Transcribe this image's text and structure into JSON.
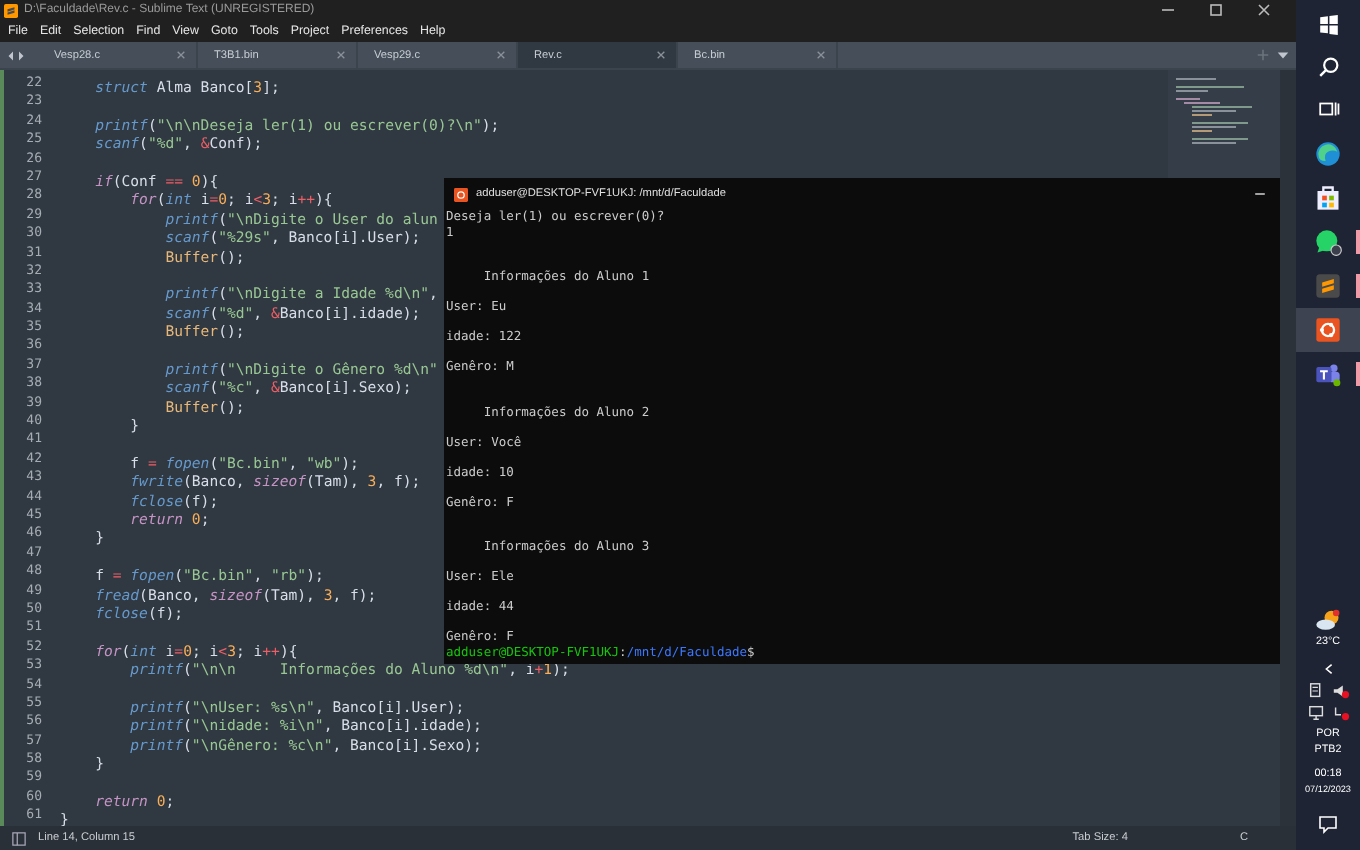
{
  "window": {
    "title": "D:\\Faculdade\\Rev.c - Sublime Text (UNREGISTERED)"
  },
  "menu": [
    "File",
    "Edit",
    "Selection",
    "Find",
    "View",
    "Goto",
    "Tools",
    "Project",
    "Preferences",
    "Help"
  ],
  "tabs": [
    {
      "label": "Vesp28.c",
      "selected": false
    },
    {
      "label": "T3B1.bin",
      "selected": false
    },
    {
      "label": "Vesp29.c",
      "selected": false
    },
    {
      "label": "Rev.c",
      "selected": true
    },
    {
      "label": "Bc.bin",
      "selected": false
    }
  ],
  "editor": {
    "lines": [
      {
        "number": "22",
        "segments": [
          {
            "kind": "type",
            "text": "    struct"
          },
          {
            "kind": "plain",
            "text": " Alma Banco["
          },
          {
            "kind": "number",
            "text": "3"
          },
          {
            "kind": "plain",
            "text": "];"
          }
        ]
      },
      {
        "number": "23"
      },
      {
        "number": "24",
        "segments": [
          {
            "kind": "function",
            "text": "    printf"
          },
          {
            "kind": "plain",
            "text": "("
          },
          {
            "kind": "string",
            "text": "\"\\n\\nDeseja ler(1) ou escrever(0)?\\n\""
          },
          {
            "kind": "plain",
            "text": ");"
          }
        ]
      },
      {
        "number": "25",
        "segments": [
          {
            "kind": "function",
            "text": "    scanf"
          },
          {
            "kind": "plain",
            "text": "("
          },
          {
            "kind": "string",
            "text": "\"%d\""
          },
          {
            "kind": "plain",
            "text": ", "
          },
          {
            "kind": "operator",
            "text": "&"
          },
          {
            "kind": "plain",
            "text": "Conf);"
          }
        ]
      },
      {
        "number": "26"
      },
      {
        "number": "27",
        "segments": [
          {
            "kind": "keyword",
            "text": "    if"
          },
          {
            "kind": "plain",
            "text": "(Conf "
          },
          {
            "kind": "operator",
            "text": "=="
          },
          {
            "kind": "number",
            "text": " 0"
          },
          {
            "kind": "plain",
            "text": "){"
          }
        ]
      },
      {
        "number": "28",
        "segments": [
          {
            "kind": "keyword",
            "text": "        for"
          },
          {
            "kind": "plain",
            "text": "("
          },
          {
            "kind": "type",
            "text": "int"
          },
          {
            "kind": "plain",
            "text": " i"
          },
          {
            "kind": "operator",
            "text": "="
          },
          {
            "kind": "number",
            "text": "0"
          },
          {
            "kind": "plain",
            "text": "; i"
          },
          {
            "kind": "operator",
            "text": "<"
          },
          {
            "kind": "number",
            "text": "3"
          },
          {
            "kind": "plain",
            "text": "; i"
          },
          {
            "kind": "operator",
            "text": "++"
          },
          {
            "kind": "plain",
            "text": "){"
          }
        ]
      },
      {
        "number": "29",
        "segments": [
          {
            "kind": "function",
            "text": "            printf"
          },
          {
            "kind": "plain",
            "text": "("
          },
          {
            "kind": "string",
            "text": "\"\\nDigite o User do alun"
          }
        ]
      },
      {
        "number": "30",
        "segments": [
          {
            "kind": "function",
            "text": "            scanf"
          },
          {
            "kind": "plain",
            "text": "("
          },
          {
            "kind": "string",
            "text": "\"%29s\""
          },
          {
            "kind": "plain",
            "text": ", Banco[i].User);"
          }
        ]
      },
      {
        "number": "31",
        "segments": [
          {
            "kind": "call",
            "text": "            Buffer"
          },
          {
            "kind": "plain",
            "text": "();"
          }
        ]
      },
      {
        "number": "32"
      },
      {
        "number": "33",
        "segments": [
          {
            "kind": "function",
            "text": "            printf"
          },
          {
            "kind": "plain",
            "text": "("
          },
          {
            "kind": "string",
            "text": "\"\\nDigite a Idade %d\\n\""
          },
          {
            "kind": "plain",
            "text": ","
          }
        ]
      },
      {
        "number": "34",
        "segments": [
          {
            "kind": "function",
            "text": "            scanf"
          },
          {
            "kind": "plain",
            "text": "("
          },
          {
            "kind": "string",
            "text": "\"%d\""
          },
          {
            "kind": "plain",
            "text": ", "
          },
          {
            "kind": "operator",
            "text": "&"
          },
          {
            "kind": "plain",
            "text": "Banco[i].idade);"
          }
        ]
      },
      {
        "number": "35",
        "segments": [
          {
            "kind": "call",
            "text": "            Buffer"
          },
          {
            "kind": "plain",
            "text": "();"
          }
        ]
      },
      {
        "number": "36"
      },
      {
        "number": "37",
        "segments": [
          {
            "kind": "function",
            "text": "            printf"
          },
          {
            "kind": "plain",
            "text": "("
          },
          {
            "kind": "string",
            "text": "\"\\nDigite o Gênero %d\\n\""
          }
        ]
      },
      {
        "number": "38",
        "segments": [
          {
            "kind": "function",
            "text": "            scanf"
          },
          {
            "kind": "plain",
            "text": "("
          },
          {
            "kind": "string",
            "text": "\"%c\""
          },
          {
            "kind": "plain",
            "text": ", "
          },
          {
            "kind": "operator",
            "text": "&"
          },
          {
            "kind": "plain",
            "text": "Banco[i].Sexo);"
          }
        ]
      },
      {
        "number": "39",
        "segments": [
          {
            "kind": "call",
            "text": "            Buffer"
          },
          {
            "kind": "plain",
            "text": "();"
          }
        ]
      },
      {
        "number": "40",
        "segments": [
          {
            "kind": "plain",
            "text": "        }"
          }
        ]
      },
      {
        "number": "41"
      },
      {
        "number": "42",
        "segments": [
          {
            "kind": "plain",
            "text": "        f "
          },
          {
            "kind": "operator",
            "text": "="
          },
          {
            "kind": "function",
            "text": " fopen"
          },
          {
            "kind": "plain",
            "text": "("
          },
          {
            "kind": "string",
            "text": "\"Bc.bin\""
          },
          {
            "kind": "plain",
            "text": ", "
          },
          {
            "kind": "string",
            "text": "\"wb\""
          },
          {
            "kind": "plain",
            "text": ");"
          }
        ]
      },
      {
        "number": "43",
        "segments": [
          {
            "kind": "function",
            "text": "        fwrite"
          },
          {
            "kind": "plain",
            "text": "(Banco, "
          },
          {
            "kind": "keyword",
            "text": "sizeof"
          },
          {
            "kind": "plain",
            "text": "(Tam), "
          },
          {
            "kind": "number",
            "text": "3"
          },
          {
            "kind": "plain",
            "text": ", f);"
          }
        ]
      },
      {
        "number": "44",
        "segments": [
          {
            "kind": "function",
            "text": "        fclose"
          },
          {
            "kind": "plain",
            "text": "(f);"
          }
        ]
      },
      {
        "number": "45",
        "segments": [
          {
            "kind": "keyword",
            "text": "        return"
          },
          {
            "kind": "number",
            "text": " 0"
          },
          {
            "kind": "plain",
            "text": ";"
          }
        ]
      },
      {
        "number": "46",
        "segments": [
          {
            "kind": "plain",
            "text": "    }"
          }
        ]
      },
      {
        "number": "47"
      },
      {
        "number": "48",
        "segments": [
          {
            "kind": "plain",
            "text": "    f "
          },
          {
            "kind": "operator",
            "text": "="
          },
          {
            "kind": "function",
            "text": " fopen"
          },
          {
            "kind": "plain",
            "text": "("
          },
          {
            "kind": "string",
            "text": "\"Bc.bin\""
          },
          {
            "kind": "plain",
            "text": ", "
          },
          {
            "kind": "string",
            "text": "\"rb\""
          },
          {
            "kind": "plain",
            "text": ");"
          }
        ]
      },
      {
        "number": "49",
        "segments": [
          {
            "kind": "function",
            "text": "    fread"
          },
          {
            "kind": "plain",
            "text": "(Banco, "
          },
          {
            "kind": "keyword",
            "text": "sizeof"
          },
          {
            "kind": "plain",
            "text": "(Tam), "
          },
          {
            "kind": "number",
            "text": "3"
          },
          {
            "kind": "plain",
            "text": ", f);"
          }
        ]
      },
      {
        "number": "50",
        "segments": [
          {
            "kind": "function",
            "text": "    fclose"
          },
          {
            "kind": "plain",
            "text": "(f);"
          }
        ]
      },
      {
        "number": "51"
      },
      {
        "number": "52",
        "segments": [
          {
            "kind": "keyword",
            "text": "    for"
          },
          {
            "kind": "plain",
            "text": "("
          },
          {
            "kind": "type",
            "text": "int"
          },
          {
            "kind": "plain",
            "text": " i"
          },
          {
            "kind": "operator",
            "text": "="
          },
          {
            "kind": "number",
            "text": "0"
          },
          {
            "kind": "plain",
            "text": "; i"
          },
          {
            "kind": "operator",
            "text": "<"
          },
          {
            "kind": "number",
            "text": "3"
          },
          {
            "kind": "plain",
            "text": "; i"
          },
          {
            "kind": "operator",
            "text": "++"
          },
          {
            "kind": "plain",
            "text": "){"
          }
        ]
      },
      {
        "number": "53",
        "segments": [
          {
            "kind": "function",
            "text": "        printf"
          },
          {
            "kind": "plain",
            "text": "("
          },
          {
            "kind": "string",
            "text": "\"\\n\\n     Informações do Aluno %d\\n\""
          },
          {
            "kind": "plain",
            "text": ", i"
          },
          {
            "kind": "operator",
            "text": "+"
          },
          {
            "kind": "number",
            "text": "1"
          },
          {
            "kind": "plain",
            "text": ");"
          }
        ]
      },
      {
        "number": "54"
      },
      {
        "number": "55",
        "segments": [
          {
            "kind": "function",
            "text": "        printf"
          },
          {
            "kind": "plain",
            "text": "("
          },
          {
            "kind": "string",
            "text": "\"\\nUser: %s\\n\""
          },
          {
            "kind": "plain",
            "text": ", Banco[i].User);"
          }
        ]
      },
      {
        "number": "56",
        "segments": [
          {
            "kind": "function",
            "text": "        printf"
          },
          {
            "kind": "plain",
            "text": "("
          },
          {
            "kind": "string",
            "text": "\"\\nidade: %i\\n\""
          },
          {
            "kind": "plain",
            "text": ", Banco[i].idade);"
          }
        ]
      },
      {
        "number": "57",
        "segments": [
          {
            "kind": "function",
            "text": "        printf"
          },
          {
            "kind": "plain",
            "text": "("
          },
          {
            "kind": "string",
            "text": "\"\\nGênero: %c\\n\""
          },
          {
            "kind": "plain",
            "text": ", Banco[i].Sexo);"
          }
        ]
      },
      {
        "number": "58",
        "segments": [
          {
            "kind": "plain",
            "text": "    }"
          }
        ]
      },
      {
        "number": "59"
      },
      {
        "number": "60",
        "segments": [
          {
            "kind": "keyword",
            "text": "    return"
          },
          {
            "kind": "number",
            "text": " 0"
          },
          {
            "kind": "plain",
            "text": ";"
          }
        ]
      },
      {
        "number": "61",
        "segments": [
          {
            "kind": "plain",
            "text": "}"
          }
        ]
      }
    ]
  },
  "status_bar": {
    "position": "Line 14, Column 15",
    "tab_size": "Tab Size: 4",
    "syntax": "C"
  },
  "terminal": {
    "title": "adduser@DESKTOP-FVF1UKJ: /mnt/d/Faculdade",
    "lines": [
      {
        "kind": "line",
        "text": "Deseja ler(1) ou escrever(0)?"
      },
      {
        "kind": "line",
        "text": "1"
      },
      {
        "kind": "heading",
        "text": "     Informações do Aluno 1"
      },
      {
        "kind": "field",
        "text": "User: Eu"
      },
      {
        "kind": "field",
        "text": "idade: 122"
      },
      {
        "kind": "field",
        "text": "Genêro: M"
      },
      {
        "kind": "heading",
        "text": "     Informações do Aluno 2"
      },
      {
        "kind": "field",
        "text": "User: Você"
      },
      {
        "kind": "field",
        "text": "idade: 10"
      },
      {
        "kind": "field",
        "text": "Genêro: F"
      },
      {
        "kind": "heading",
        "text": "     Informações do Aluno 3"
      },
      {
        "kind": "field",
        "text": "User: Ele"
      },
      {
        "kind": "field",
        "text": "idade: 44"
      },
      {
        "kind": "field",
        "text": "Genêro: F"
      }
    ],
    "prompt": {
      "user_host": "adduser@DESKTOP-FVF1UKJ",
      "separator": ":",
      "path": "/mnt/d/Faculdade",
      "symbol": "$"
    }
  },
  "taskbar": {
    "apps": [
      {
        "kind": "edge",
        "selected": false,
        "running": false
      },
      {
        "kind": "store",
        "selected": false,
        "running": false
      },
      {
        "kind": "whatsapp",
        "selected": false,
        "running": true
      },
      {
        "kind": "sublime",
        "selected": false,
        "running": true
      },
      {
        "kind": "ubuntu",
        "selected": true,
        "running": false
      },
      {
        "kind": "teams",
        "selected": false,
        "running": true
      }
    ],
    "temperature": "23°C",
    "language": "POR",
    "layout": "PTB2",
    "time": "00:18",
    "date": "07/12/2023"
  }
}
